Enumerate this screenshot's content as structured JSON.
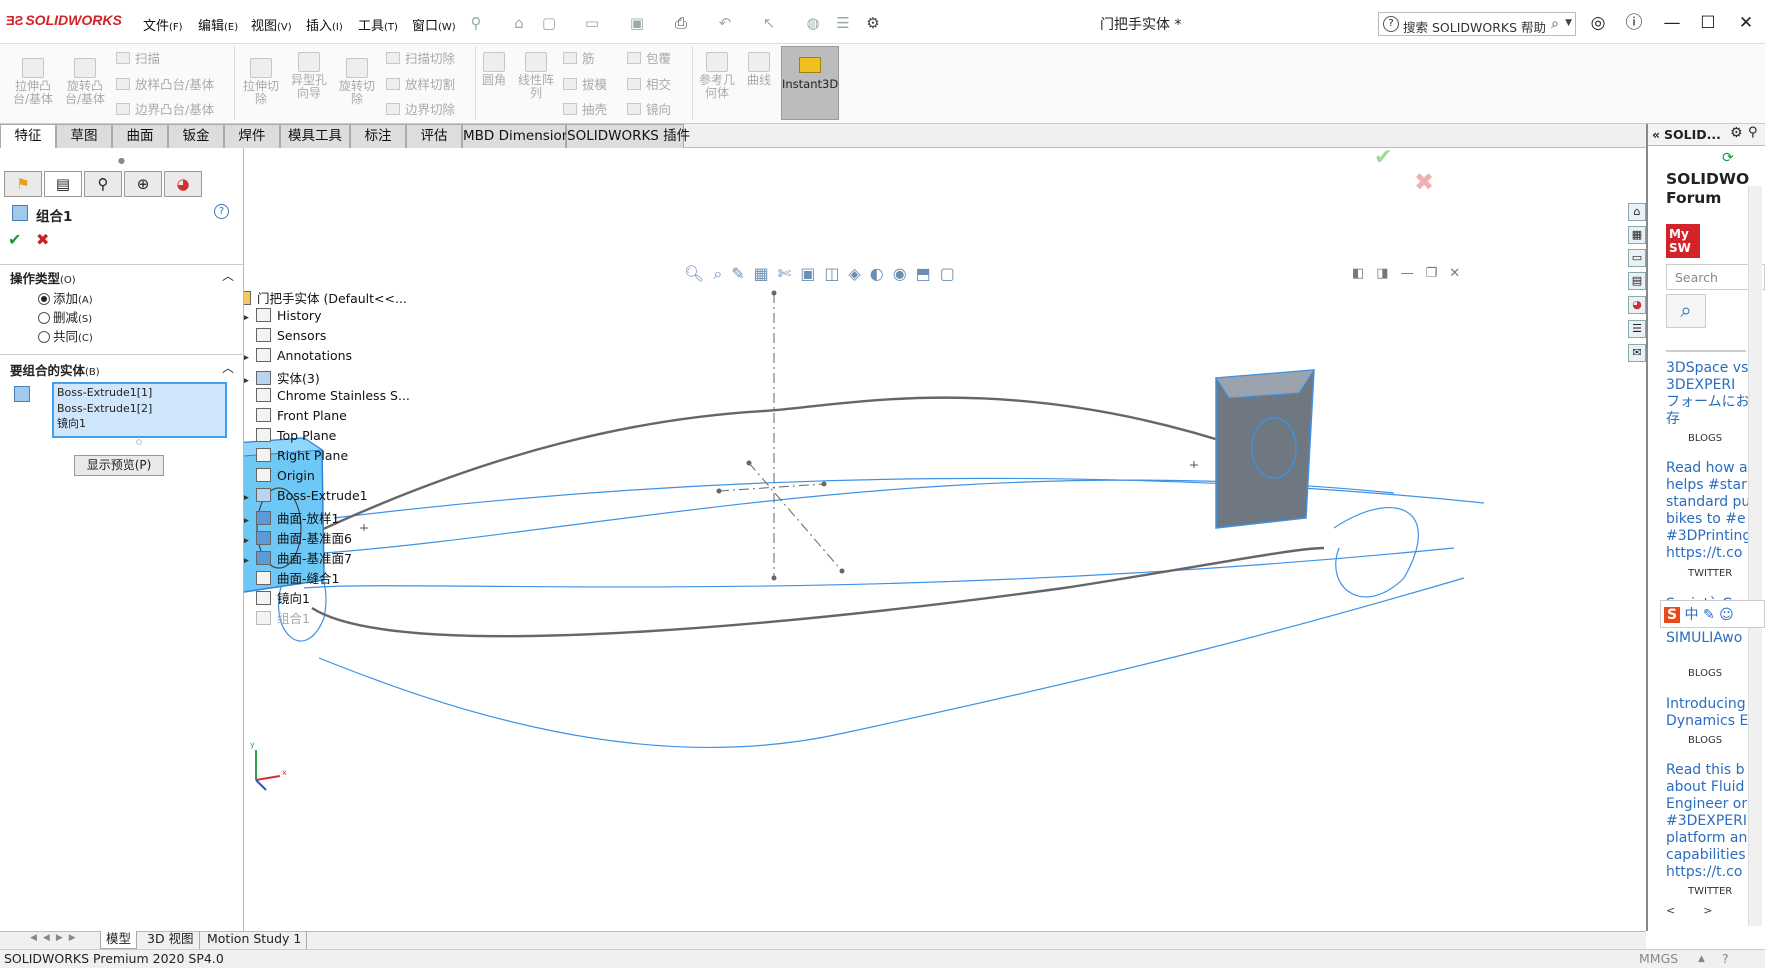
{
  "app": {
    "logo": "SOLIDWORKS",
    "doc_title": "门把手实体 *"
  },
  "menus": [
    {
      "label": "文件",
      "key": "(F)"
    },
    {
      "label": "编辑",
      "key": "(E)"
    },
    {
      "label": "视图",
      "key": "(V)"
    },
    {
      "label": "插入",
      "key": "(I)"
    },
    {
      "label": "工具",
      "key": "(T)"
    },
    {
      "label": "窗口",
      "key": "(W)"
    }
  ],
  "search": {
    "placeholder": "搜索 SOLIDWORKS 帮助"
  },
  "toolbar": {
    "extrude_boss": "拉伸凸\n台/基体",
    "revolve_boss": "旋转凸\n台/基体",
    "sweep": "扫描",
    "loft_boss": "放样凸台/基体",
    "boundary_boss": "边界凸台/基体",
    "extrude_cut": "拉伸切\n除",
    "hole_wizard": "异型孔\n向导",
    "revolve_cut": "旋转切\n除",
    "swept_cut": "扫描切除",
    "lofted_cut": "放样切割",
    "boundary_cut": "边界切除",
    "fillet": "圆角",
    "linear_pattern": "线性阵\n列",
    "rib": "筋",
    "draft": "拔模",
    "shell": "抽壳",
    "wrap": "包覆",
    "intersect": "相交",
    "mirror": "镜向",
    "ref_geometry": "参考几\n何体",
    "curves": "曲线",
    "instant3d": "Instant3D"
  },
  "tabs": [
    "特征",
    "草图",
    "曲面",
    "钣金",
    "焊件",
    "模具工具",
    "标注",
    "评估",
    "MBD Dimensions",
    "SOLIDWORKS 插件"
  ],
  "property_manager": {
    "title": "组合1",
    "op_section": {
      "label": "操作类型",
      "key": "(O)"
    },
    "options": [
      {
        "label": "添加",
        "key": "(A)",
        "selected": true
      },
      {
        "label": "删减",
        "key": "(S)",
        "selected": false
      },
      {
        "label": "共同",
        "key": "(C)",
        "selected": false
      }
    ],
    "bodies_section": {
      "label": "要组合的实体",
      "key": "(B)"
    },
    "bodies": [
      "Boss-Extrude1[1]",
      "Boss-Extrude1[2]",
      "镜向1"
    ],
    "preview_button": "显示预览(P)"
  },
  "tree": [
    {
      "label": "门把手实体  (Default<<...",
      "arrow": "▼"
    },
    {
      "label": "History",
      "arrow": "▶"
    },
    {
      "label": "Sensors",
      "arrow": ""
    },
    {
      "label": "Annotations",
      "arrow": "▶"
    },
    {
      "label": "实体(3)",
      "arrow": "▶"
    },
    {
      "label": "Chrome Stainless S...",
      "arrow": ""
    },
    {
      "label": "Front Plane",
      "arrow": ""
    },
    {
      "label": "Top Plane",
      "arrow": ""
    },
    {
      "label": "Right Plane",
      "arrow": ""
    },
    {
      "label": "Origin",
      "arrow": ""
    },
    {
      "label": "Boss-Extrude1",
      "arrow": "▶"
    },
    {
      "label": "曲面-放样1",
      "arrow": "▶"
    },
    {
      "label": "曲面-基准面6",
      "arrow": "▶"
    },
    {
      "label": "曲面-基准面7",
      "arrow": "▶"
    },
    {
      "label": "曲面-缝合1",
      "arrow": ""
    },
    {
      "label": "镜向1",
      "arrow": ""
    },
    {
      "label": "组合1",
      "arrow": ""
    }
  ],
  "triad": {
    "x": "x",
    "y": "y"
  },
  "resources": {
    "header": "SOLID...",
    "forum_title": "SOLIDWO\nForum",
    "mysw": "My\nSW",
    "search_placeholder": "Search",
    "items": [
      {
        "text": "3DSpace vs\n3DEXPERI\nフォームにお\n存",
        "tag": "BLOGS"
      },
      {
        "text": "Read how a\nhelps #star\nstandard pu\nbikes to #e\n#3DPrinting\nhttps://t.co",
        "tag": "TWITTER"
      },
      {
        "text": "Società Cor\nPrototypen\nSIMULIAwo",
        "tag": "BLOGS"
      },
      {
        "text": "Introducing\nDynamics E",
        "tag": "BLOGS"
      },
      {
        "text": "Read this b\nabout Fluid\nEngineer or\n#3DEXPERI\nplatform an\ncapabilities\nhttps://t.co",
        "tag": "TWITTER"
      }
    ]
  },
  "bottom_tabs": [
    "模型",
    "3D 视图",
    "Motion Study 1"
  ],
  "status": {
    "left": "SOLIDWORKS Premium 2020 SP4.0",
    "units": "MMGS"
  },
  "colors": {
    "accent": "#3fa2f0",
    "brand": "#d2232a",
    "selected_body": "#6ec8f5"
  }
}
